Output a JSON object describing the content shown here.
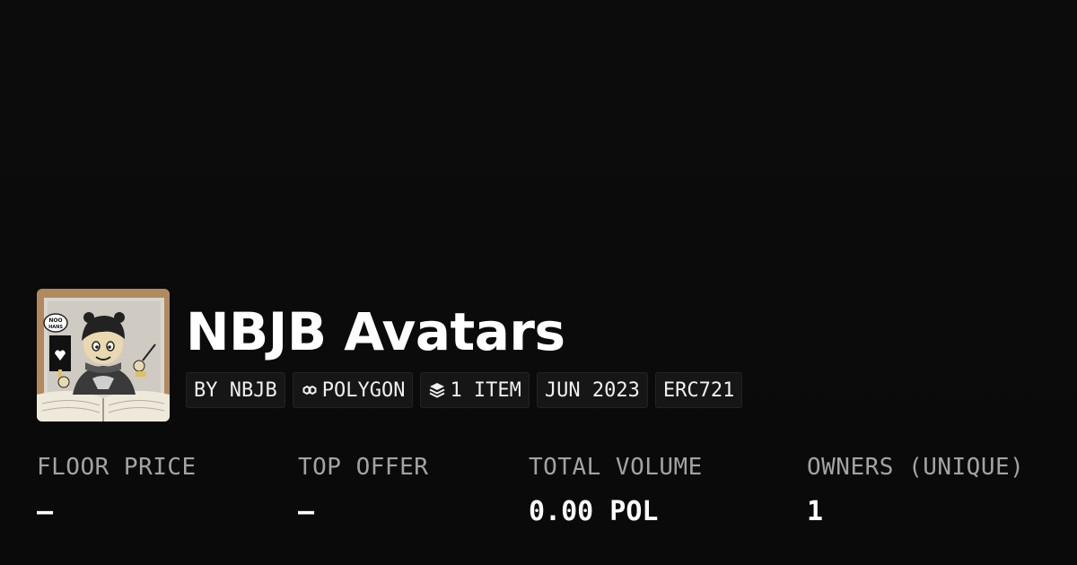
{
  "collection": {
    "title": "NBJB Avatars",
    "avatar_alt": "NBJB avatar artwork",
    "chips": [
      {
        "label": "BY NBJB",
        "icon": ""
      },
      {
        "label": "POLYGON",
        "icon": "polygon-chain-icon"
      },
      {
        "label": "1 ITEM",
        "icon": "layers-icon"
      },
      {
        "label": "JUN 2023",
        "icon": ""
      },
      {
        "label": "ERC721",
        "icon": ""
      }
    ]
  },
  "stats": [
    {
      "label": "FLOOR PRICE",
      "value": "–"
    },
    {
      "label": "TOP OFFER",
      "value": "–"
    },
    {
      "label": "TOTAL VOLUME",
      "value": "0.00 POL"
    },
    {
      "label": "OWNERS (UNIQUE)",
      "value": "1"
    }
  ],
  "colors": {
    "background": "#0a0a0a",
    "chip_background": "#161616",
    "label_gray": "#a3a3a3",
    "text": "#ffffff"
  }
}
